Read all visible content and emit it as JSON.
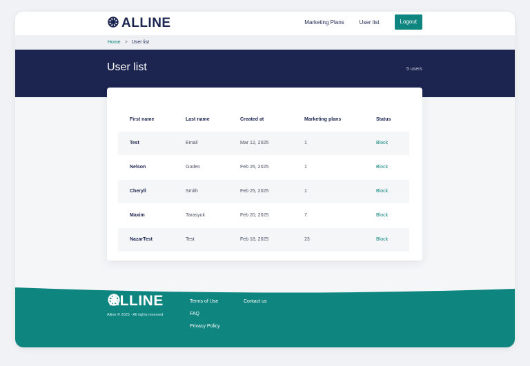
{
  "header": {
    "brand": "ALLINE",
    "nav": {
      "marketing_plans": "Marketing Plans",
      "user_list": "User list",
      "logout": "Logout"
    }
  },
  "breadcrumb": {
    "home": "Home",
    "separator": ">",
    "current": "User list"
  },
  "banner": {
    "title": "User list",
    "count": "5 users"
  },
  "table": {
    "columns": [
      "First name",
      "Last name",
      "Created at",
      "Marketing plans",
      "Status"
    ],
    "rows": [
      {
        "first": "Test",
        "last": "Email",
        "created": "Mar 12, 2025",
        "plans": "1",
        "status": "Block"
      },
      {
        "first": "Nelson",
        "last": "Goden",
        "created": "Feb 26, 2025",
        "plans": "1",
        "status": "Block"
      },
      {
        "first": "Cheryll",
        "last": "Smith",
        "created": "Feb 25, 2025",
        "plans": "1",
        "status": "Block"
      },
      {
        "first": "Maxim",
        "last": "Tarasyuk",
        "created": "Feb 20, 2025",
        "plans": "7",
        "status": "Block"
      },
      {
        "first": "NazarTest",
        "last": "Test",
        "created": "Feb 18, 2025",
        "plans": "23",
        "status": "Block"
      }
    ]
  },
  "footer": {
    "brand": "ALLINE",
    "copyright": "Alline © 2025 · All rights reserved",
    "links_col1": [
      "Terms of Use",
      "FAQ",
      "Privacy Policy"
    ],
    "links_col2": [
      "Contact us"
    ]
  },
  "colors": {
    "navy": "#1b2550",
    "teal": "#0f8580",
    "background": "#f5f6f8"
  },
  "icons": {
    "logo": "alline-logo-icon"
  }
}
